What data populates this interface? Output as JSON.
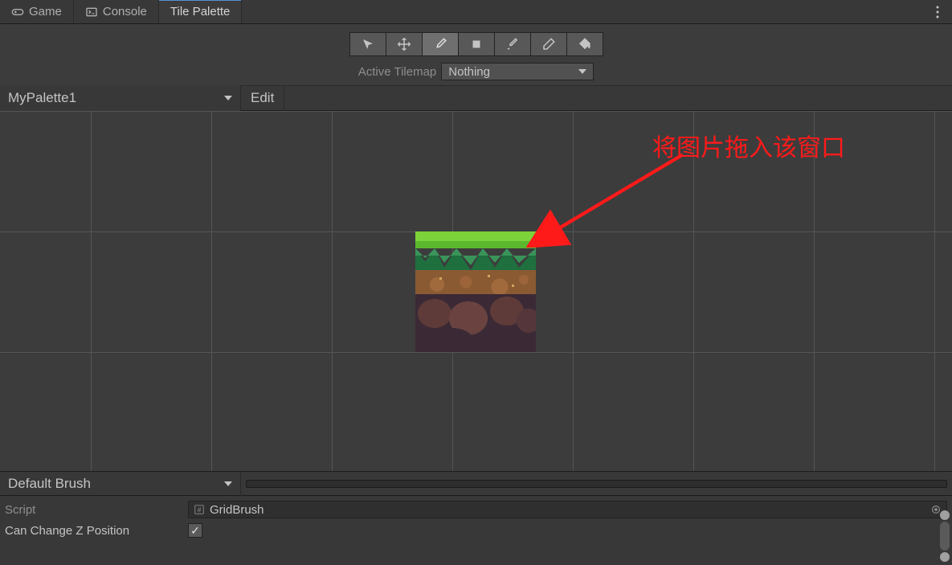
{
  "tabs": {
    "game": "Game",
    "console": "Console",
    "tile_palette": "Tile Palette"
  },
  "toolbar": {
    "active_tilemap_label": "Active Tilemap",
    "active_tilemap_value": "Nothing"
  },
  "palette": {
    "selected": "MyPalette1",
    "edit_label": "Edit"
  },
  "annotation_text": "将图片拖入该窗口",
  "brush": {
    "selected": "Default Brush"
  },
  "inspector": {
    "script_label": "Script",
    "script_value": "GridBrush",
    "can_change_z_label": "Can Change Z Position",
    "can_change_z_checked": true
  }
}
